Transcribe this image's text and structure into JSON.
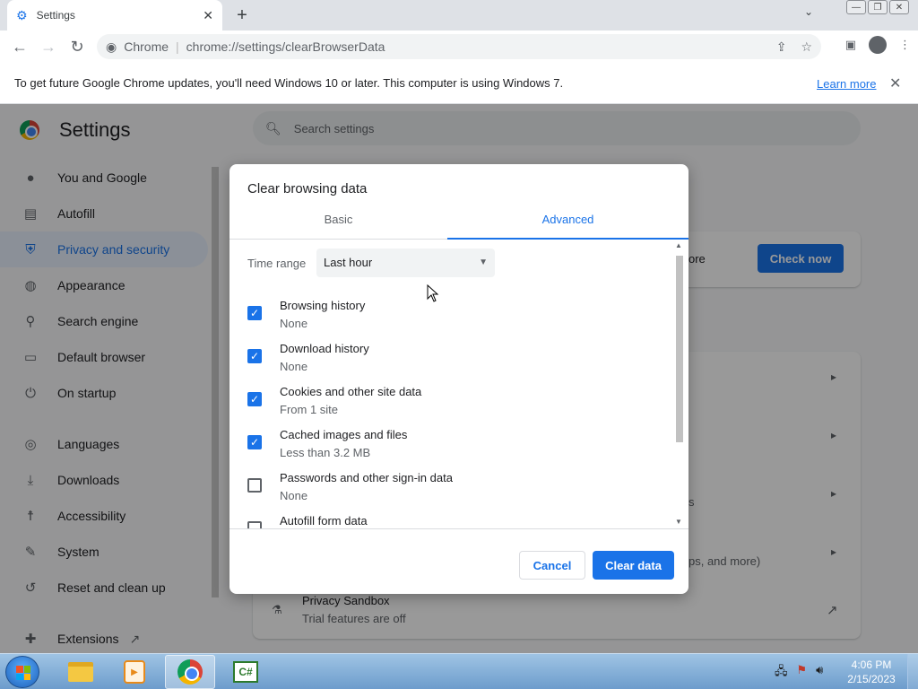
{
  "browser": {
    "tab_title": "Settings",
    "tab_close": "✕",
    "new_tab": "+",
    "tab_menu": "⌄",
    "window_buttons": [
      "—",
      "❐",
      "✕"
    ],
    "omnibox": {
      "site": "Chrome",
      "url": "chrome://settings/clearBrowserData"
    }
  },
  "infobar": {
    "message": "To get future Google Chrome updates, you'll need Windows 10 or later. This computer is using Windows 7.",
    "learn_more": "Learn more",
    "close": "✕"
  },
  "settings": {
    "title": "Settings",
    "search_placeholder": "Search settings",
    "sidebar": [
      {
        "label": "You and Google",
        "icon": "person-icon"
      },
      {
        "label": "Autofill",
        "icon": "clipboard-icon"
      },
      {
        "label": "Privacy and security",
        "icon": "shield-icon",
        "active": true
      },
      {
        "label": "Appearance",
        "icon": "palette-icon"
      },
      {
        "label": "Search engine",
        "icon": "search-icon"
      },
      {
        "label": "Default browser",
        "icon": "browser-icon"
      },
      {
        "label": "On startup",
        "icon": "power-icon"
      },
      {
        "label": "Languages",
        "icon": "globe-icon"
      },
      {
        "label": "Downloads",
        "icon": "download-icon"
      },
      {
        "label": "Accessibility",
        "icon": "accessibility-icon"
      },
      {
        "label": "System",
        "icon": "wrench-icon"
      },
      {
        "label": "Reset and clean up",
        "icon": "history-icon"
      },
      {
        "label": "Extensions",
        "icon": "puzzle-icon"
      }
    ],
    "bg": {
      "check_now": "Check now",
      "safety_fragment": "ore",
      "fragment_s": "s",
      "fragment_more": "ps, and more)",
      "privacy_sandbox": "Privacy Sandbox",
      "privacy_sandbox_sub": "Trial features are off"
    }
  },
  "dialog": {
    "title": "Clear browsing data",
    "tabs": {
      "basic": "Basic",
      "advanced": "Advanced"
    },
    "time_range_label": "Time range",
    "time_range_value": "Last hour",
    "options": [
      {
        "label": "Browsing history",
        "sub": "None",
        "checked": true
      },
      {
        "label": "Download history",
        "sub": "None",
        "checked": true
      },
      {
        "label": "Cookies and other site data",
        "sub": "From 1 site",
        "checked": true
      },
      {
        "label": "Cached images and files",
        "sub": "Less than 3.2 MB",
        "checked": true
      },
      {
        "label": "Passwords and other sign-in data",
        "sub": "None",
        "checked": false
      },
      {
        "label": "Autofill form data",
        "sub": "",
        "checked": false
      }
    ],
    "cancel": "Cancel",
    "clear": "Clear data"
  },
  "taskbar": {
    "time": "4:06 PM",
    "date": "2/15/2023",
    "csharp_label": "C#"
  },
  "colors": {
    "accent": "#1a73e8"
  }
}
